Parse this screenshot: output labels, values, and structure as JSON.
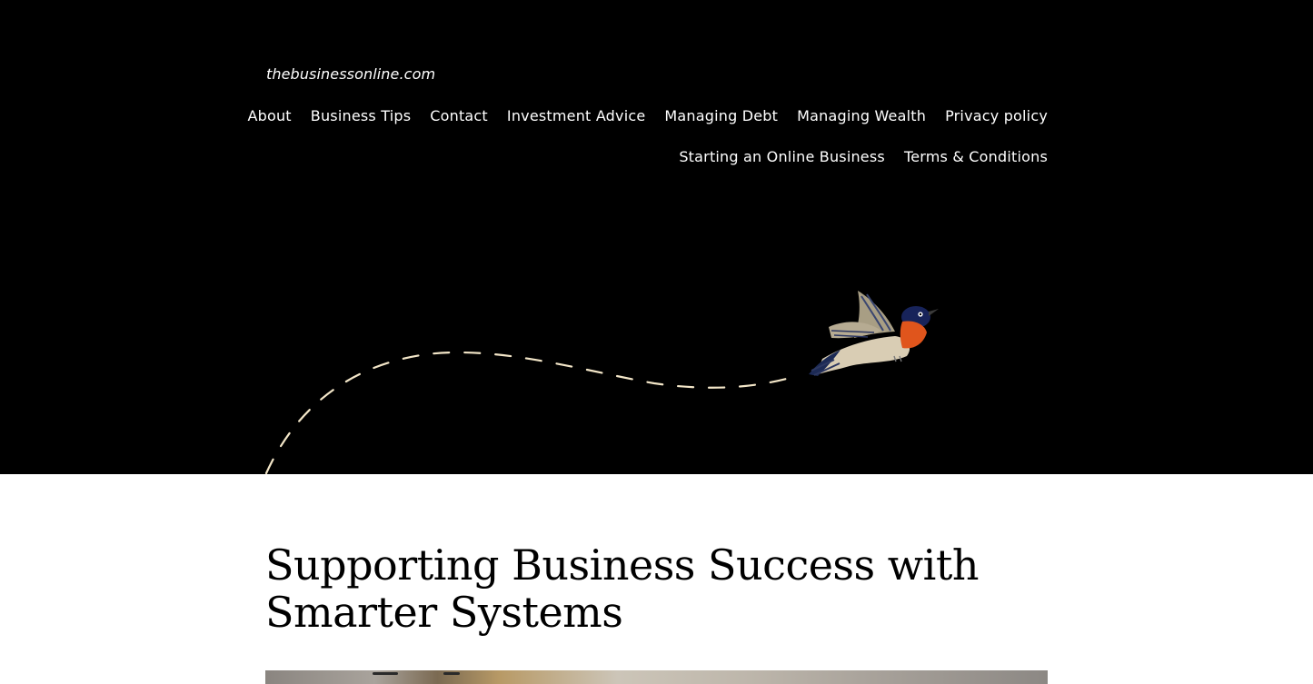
{
  "site": {
    "title": "thebusinessonline.com"
  },
  "nav": {
    "row1": [
      "About",
      "Business Tips",
      "Contact",
      "Investment Advice",
      "Managing Debt",
      "Managing Wealth",
      "Privacy policy"
    ],
    "row2": [
      "Starting an Online Business",
      "Terms & Conditions"
    ]
  },
  "post": {
    "title": "Supporting Business Success with Smarter Systems"
  },
  "colors": {
    "header_background": "#000000",
    "header_text": "#ffffff",
    "content_background": "#ffffff",
    "flight_path": "#f3e6c8",
    "bird_throat": "#e0551c",
    "bird_head": "#17235a"
  },
  "icons": {
    "flight_illustration": "bird-flight-path-icon"
  }
}
